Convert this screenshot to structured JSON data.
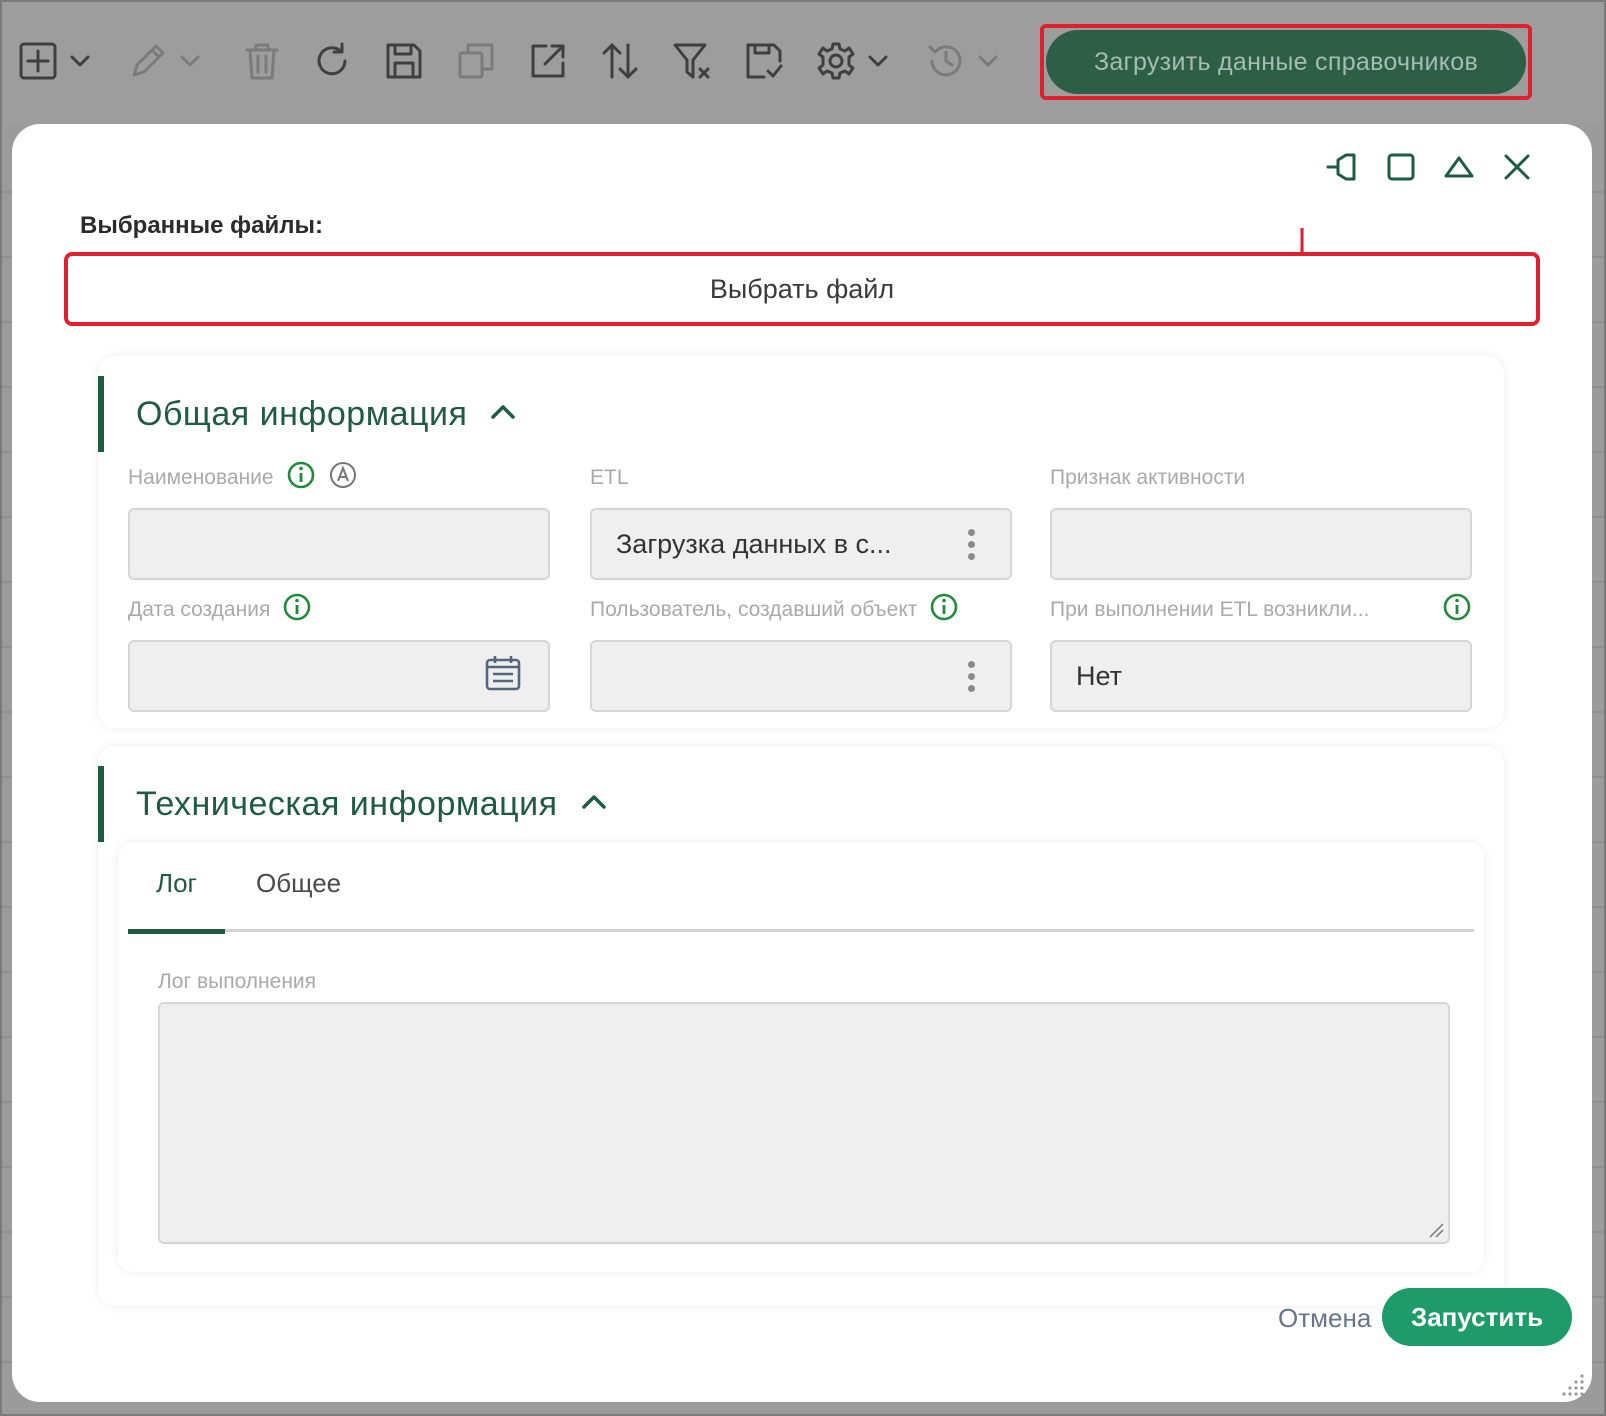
{
  "toolbar": {
    "icons": [
      "add-icon",
      "edit-icon",
      "delete-icon",
      "refresh-icon",
      "save-icon",
      "copy-icon",
      "export-icon",
      "sort-icon",
      "filter-clear-icon",
      "save-view-icon",
      "settings-icon",
      "history-icon"
    ],
    "load_button_label": "Загрузить данные справочников"
  },
  "dialog": {
    "files_label": "Выбранные файлы:",
    "choose_file_label": "Выбрать файл",
    "general_section": {
      "title": "Общая информация",
      "fields": {
        "name": {
          "label": "Наименование",
          "value": ""
        },
        "etl": {
          "label": "ETL",
          "value": "Загрузка данных в с..."
        },
        "active": {
          "label": "Признак активности",
          "value": ""
        },
        "created_date": {
          "label": "Дата создания",
          "value": ""
        },
        "created_by": {
          "label": "Пользователь, создавший объект",
          "value": ""
        },
        "etl_errors": {
          "label": "При выполнении ETL возникли...",
          "value": "Нет"
        }
      }
    },
    "tech_section": {
      "title": "Техническая информация",
      "tabs": [
        "Лог",
        "Общее"
      ],
      "log_label": "Лог выполнения",
      "log_value": ""
    },
    "cancel_label": "Отмена",
    "run_label": "Запустить"
  },
  "colors": {
    "accent": "#1f5a43",
    "primary_button": "#1e9b6a",
    "highlight": "#e0202e",
    "info_icon": "#1f8a3a"
  }
}
